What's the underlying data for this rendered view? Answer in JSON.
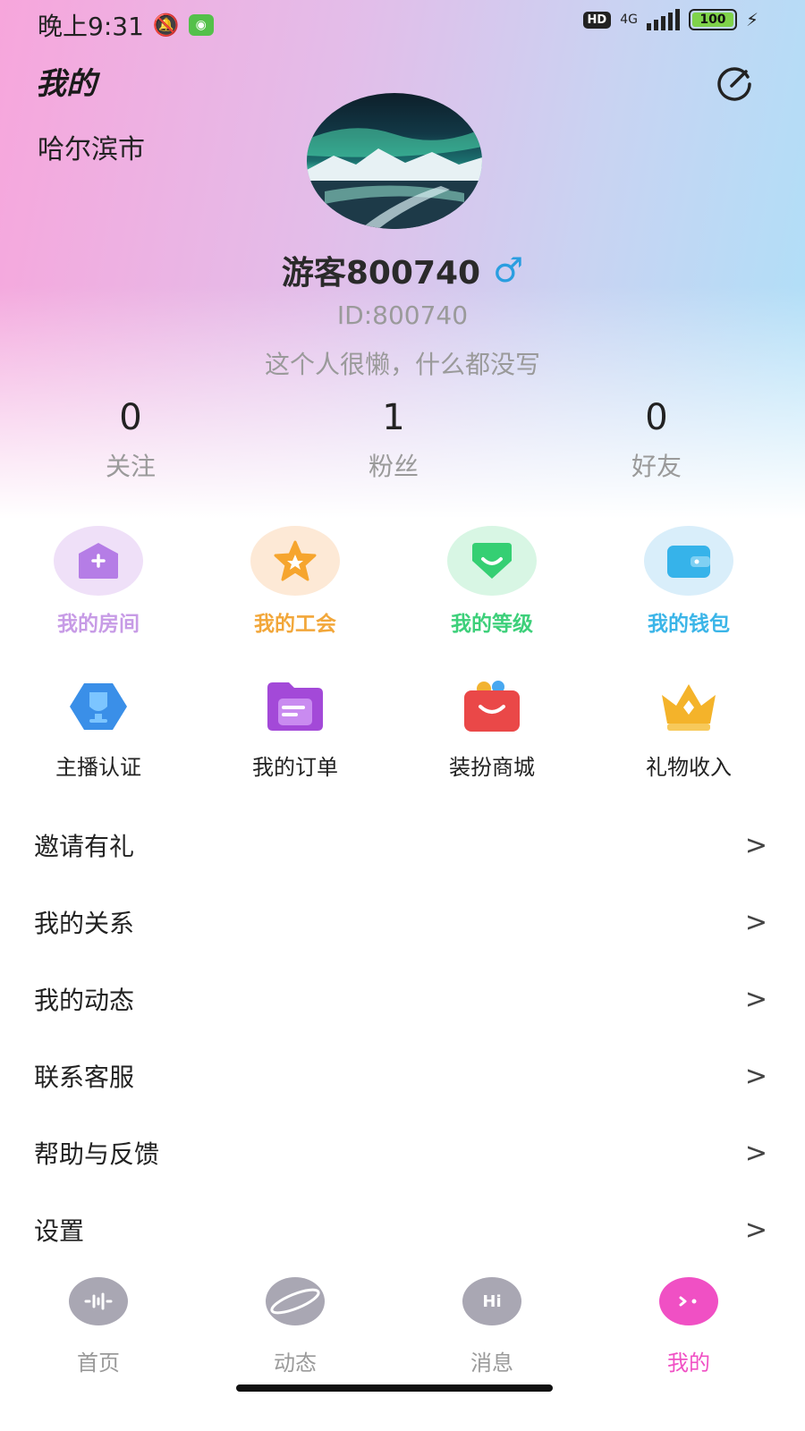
{
  "status_bar": {
    "time": "晚上9:31",
    "hd": "HD",
    "network": "4G",
    "battery": "100"
  },
  "header": {
    "title": "我的",
    "city": "哈尔滨市"
  },
  "profile": {
    "nickname": "游客800740",
    "gender_symbol": "♂",
    "id": "ID:800740",
    "bio": "这个人很懒，什么都没写"
  },
  "stats": [
    {
      "value": "0",
      "label": "关注"
    },
    {
      "value": "1",
      "label": "粉丝"
    },
    {
      "value": "0",
      "label": "好友"
    }
  ],
  "quick_actions": [
    {
      "label": "我的房间",
      "icon": "room-icon",
      "color": "#c79be6",
      "bg": "#efe0f8"
    },
    {
      "label": "我的工会",
      "icon": "guild-star-icon",
      "color": "#f2a73a",
      "bg": "#fde9d6"
    },
    {
      "label": "我的等级",
      "icon": "level-icon",
      "color": "#3dd07a",
      "bg": "#d8f6e4"
    },
    {
      "label": "我的钱包",
      "icon": "wallet-icon",
      "color": "#3bb5e8",
      "bg": "#d9eefa"
    }
  ],
  "tools": [
    {
      "label": "主播认证",
      "icon": "anchor-certification-icon"
    },
    {
      "label": "我的订单",
      "icon": "orders-icon"
    },
    {
      "label": "装扮商城",
      "icon": "dress-up-mall-icon"
    },
    {
      "label": "礼物收入",
      "icon": "gift-income-crown-icon"
    }
  ],
  "menu": [
    {
      "label": "邀请有礼"
    },
    {
      "label": "我的关系"
    },
    {
      "label": "我的动态"
    },
    {
      "label": "联系客服"
    },
    {
      "label": "帮助与反馈"
    },
    {
      "label": "设置"
    }
  ],
  "chevron": ">",
  "tabs": [
    {
      "label": "首页",
      "icon": "home-voice-icon",
      "active": false
    },
    {
      "label": "动态",
      "icon": "planet-icon",
      "active": false
    },
    {
      "label": "消息",
      "icon": "hi-message-icon",
      "icon_text": "Hi",
      "active": false
    },
    {
      "label": "我的",
      "icon": "me-icon",
      "active": true
    }
  ],
  "colors": {
    "active_tab": "#f050c4",
    "inactive_tab": "#9a9a9a",
    "gender": "#2a9ee0"
  }
}
